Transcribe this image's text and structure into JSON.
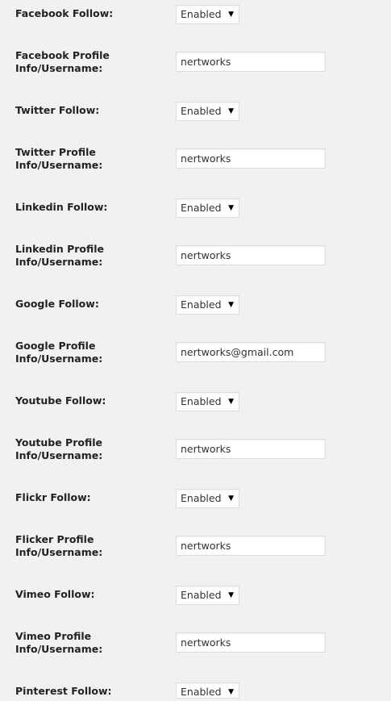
{
  "settings": [
    {
      "type": "select",
      "label": "Facebook Follow:",
      "value": "Enabled",
      "icon": "dropdown-arrow-icon"
    },
    {
      "type": "text",
      "label_line1": "Facebook Profile",
      "label_line2": "Info/Username:",
      "value": "nertworks"
    },
    {
      "type": "select",
      "label": "Twitter Follow:",
      "value": "Enabled",
      "icon": "dropdown-arrow-icon"
    },
    {
      "type": "text",
      "label_line1": "Twitter Profile",
      "label_line2": "Info/Username:",
      "value": "nertworks"
    },
    {
      "type": "select",
      "label": "Linkedin Follow:",
      "value": "Enabled",
      "icon": "dropdown-arrow-icon"
    },
    {
      "type": "text",
      "label_line1": "Linkedin Profile",
      "label_line2": "Info/Username:",
      "value": "nertworks"
    },
    {
      "type": "select",
      "label": "Google Follow:",
      "value": "Enabled",
      "icon": "dropdown-arrow-icon"
    },
    {
      "type": "text",
      "label_line1": "Google Profile",
      "label_line2": "Info/Username:",
      "value": "nertworks@gmail.com"
    },
    {
      "type": "select",
      "label": "Youtube Follow:",
      "value": "Enabled",
      "icon": "dropdown-arrow-icon"
    },
    {
      "type": "text",
      "label_line1": "Youtube Profile",
      "label_line2": "Info/Username:",
      "value": "nertworks"
    },
    {
      "type": "select",
      "label": "Flickr Follow:",
      "value": "Enabled",
      "icon": "dropdown-arrow-icon"
    },
    {
      "type": "text",
      "label_line1": "Flicker Profile",
      "label_line2": "Info/Username:",
      "value": "nertworks"
    },
    {
      "type": "select",
      "label": "Vimeo Follow:",
      "value": "Enabled",
      "icon": "dropdown-arrow-icon"
    },
    {
      "type": "text",
      "label_line1": "Vimeo Profile",
      "label_line2": "Info/Username:",
      "value": "nertworks"
    },
    {
      "type": "select",
      "label": "Pinterest Follow:",
      "value": "Enabled",
      "icon": "dropdown-arrow-icon"
    }
  ],
  "dropdown_arrow_glyph": "▼"
}
